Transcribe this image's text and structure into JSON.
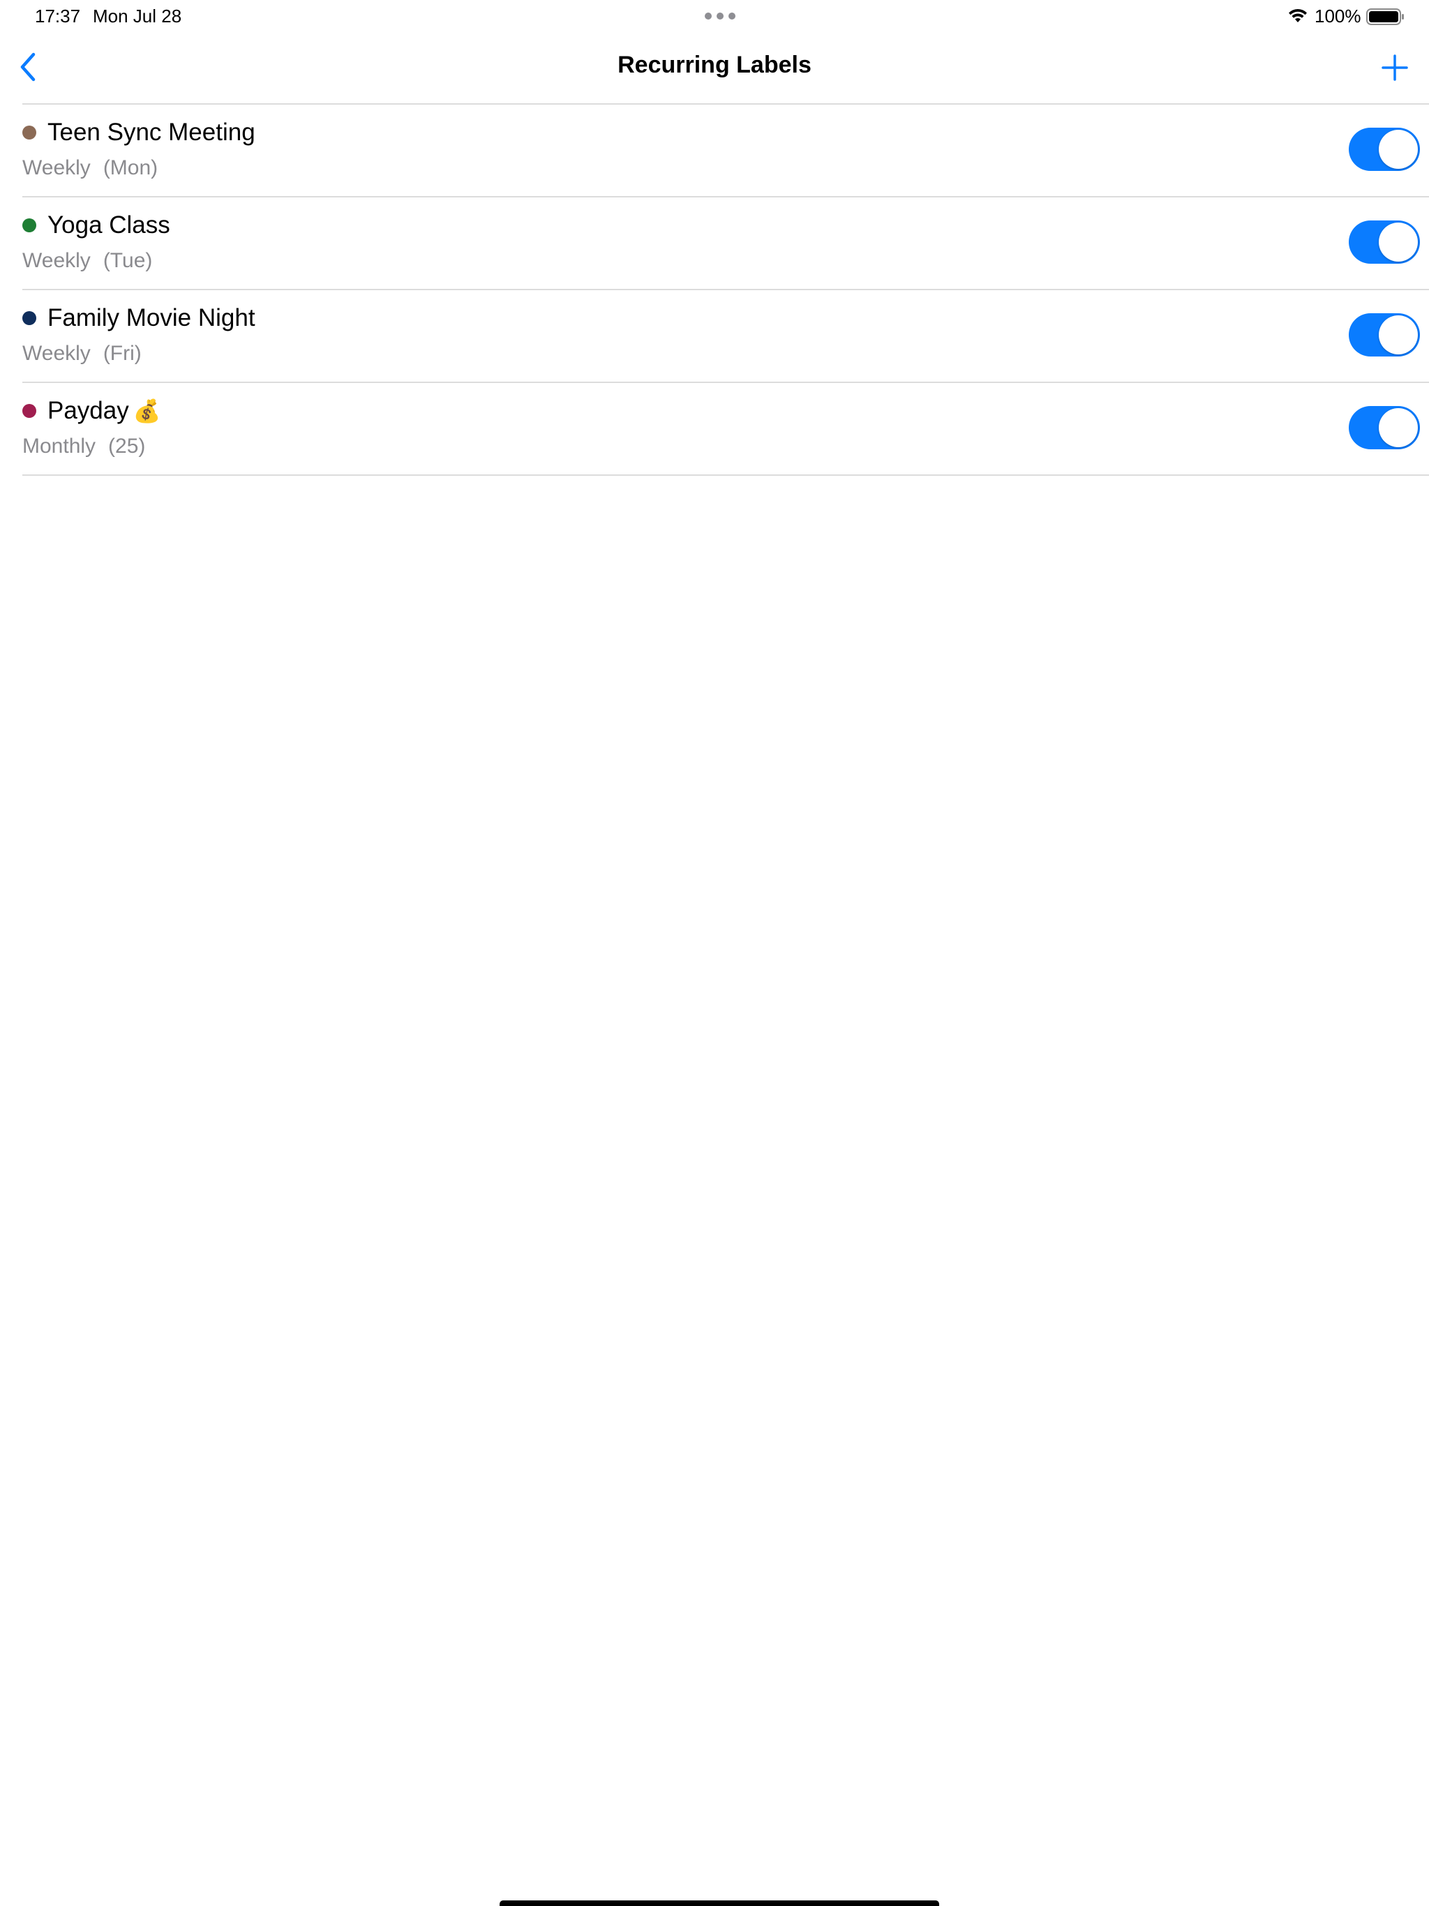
{
  "status_bar": {
    "time": "17:37",
    "date": "Mon Jul 28",
    "battery": "100%"
  },
  "nav": {
    "title": "Recurring Labels",
    "back_icon": "chevron-left-icon",
    "add_icon": "plus-icon"
  },
  "colors": {
    "accent": "#0a7cff",
    "divider": "#dcdcdc",
    "subtitle": "#8a8a8e"
  },
  "items": [
    {
      "title": "Teen Sync Meeting",
      "emoji": "",
      "frequency": "Weekly",
      "detail": "(Mon)",
      "color": "#8b6a55",
      "enabled": true
    },
    {
      "title": "Yoga Class",
      "emoji": "",
      "frequency": "Weekly",
      "detail": "(Tue)",
      "color": "#1e7e34",
      "enabled": true
    },
    {
      "title": "Family Movie Night",
      "emoji": "",
      "frequency": "Weekly",
      "detail": "(Fri)",
      "color": "#0f2e5c",
      "enabled": true
    },
    {
      "title": "Payday",
      "emoji": "💰",
      "frequency": "Monthly",
      "detail": "(25)",
      "color": "#a01e4f",
      "enabled": true
    }
  ]
}
